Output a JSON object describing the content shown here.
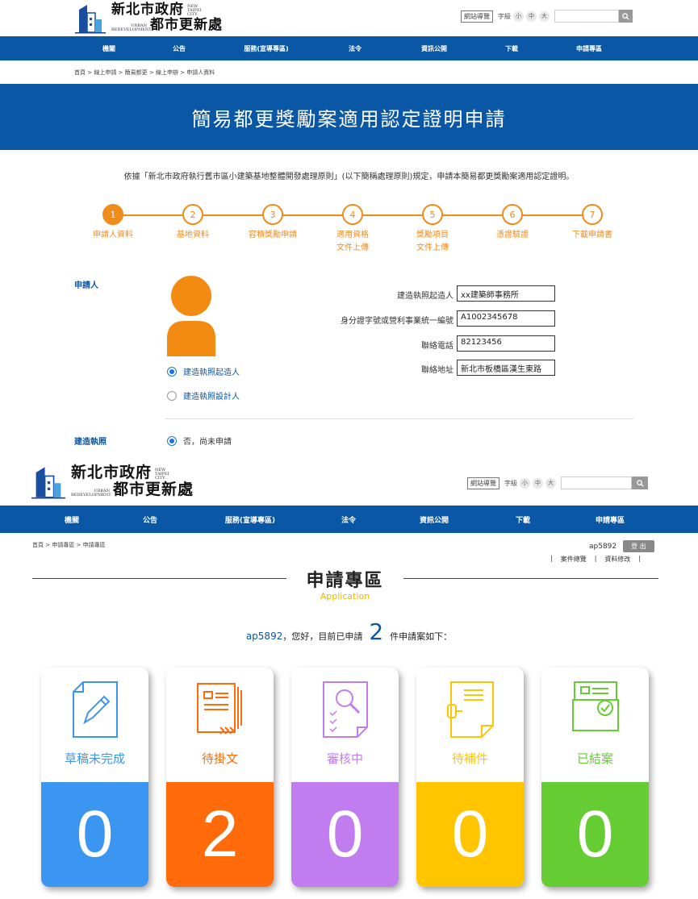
{
  "section1": {
    "logo": {
      "name_top": "新北市政府",
      "name_bottom": "都市更新處",
      "tag_en_top": "NEW TAIPEI CITY",
      "tag_en_bottom": "URBAN REDEVELOPMENT"
    },
    "tools": {
      "sitemap": "網站導覽",
      "font_label": "字級",
      "font_small": "小",
      "font_mid": "中",
      "font_large": "大",
      "search_placeholder": ""
    },
    "nav": [
      "機關",
      "公告",
      "服務(宣導專區)",
      "法令",
      "資訊公開",
      "下載",
      "申請專區"
    ],
    "breadcrumb": "首頁 > 線上申請 > 簡易都更 > 線上申辦 > 申請人資料",
    "banner_title": "簡易都更獎勵案適用認定證明申請",
    "intro": "依據「新北市政府執行舊市區小建築基地整體開發處理原則」(以下簡稱處理原則)規定，申請本簡易都更獎勵案適用認定證明。",
    "steps": [
      {
        "num": "1",
        "label1": "申請人資料",
        "label2": ""
      },
      {
        "num": "2",
        "label1": "基地資料",
        "label2": ""
      },
      {
        "num": "3",
        "label1": "容積獎勵申請",
        "label2": ""
      },
      {
        "num": "4",
        "label1": "適用資格",
        "label2": "文件上傳"
      },
      {
        "num": "5",
        "label1": "獎勵項目",
        "label2": "文件上傳"
      },
      {
        "num": "6",
        "label1": "憑證驗證",
        "label2": ""
      },
      {
        "num": "7",
        "label1": "下載申請書",
        "label2": ""
      }
    ],
    "applicant_label": "申請人",
    "radio_builder": "建造執照起造人",
    "radio_designer": "建造執照設計人",
    "fields": [
      {
        "label": "建造執照起造人",
        "value": "xx建築師事務所"
      },
      {
        "label": "身分證字號或營利事業統一編號",
        "value": "A1002345678"
      },
      {
        "label": "聯絡電話",
        "value": "82123456"
      },
      {
        "label": "聯絡地址",
        "value": "新北市板橋區漢生東路"
      }
    ],
    "permit_label": "建造執照",
    "permit_option": "否，尚未申請"
  },
  "section2": {
    "logo": {
      "name_top": "新北市政府",
      "name_bottom": "都市更新處",
      "tag_en_top": "NEW TAIPEI CITY",
      "tag_en_bottom": "URBAN REDEVELOPMENT"
    },
    "tools": {
      "sitemap": "網站導覽",
      "font_label": "字級",
      "font_small": "小",
      "font_mid": "中",
      "font_large": "大"
    },
    "nav": [
      "機關",
      "公告",
      "服務(宣導專區)",
      "法令",
      "資訊公開",
      "下載",
      "申請專區"
    ],
    "breadcrumb": "首頁 > 申請專區 > 申請專區",
    "username": "ap5892",
    "logout": "登 出",
    "link_overview": "案件總覽",
    "link_edit": "資料修改",
    "title": "申請專區",
    "subtitle": "Application",
    "greet_user": "ap5892",
    "greet_mid": "，您好，目前已申請",
    "greet_count": "2",
    "greet_end": "件申請案如下：",
    "cards": [
      {
        "label": "草稿未完成",
        "count": "0",
        "color": "#3b96f2",
        "icon": "pencil-doc-icon"
      },
      {
        "label": "待掛文",
        "count": "2",
        "color": "#ff6a0b",
        "icon": "stack-doc-icon"
      },
      {
        "label": "審核中",
        "count": "0",
        "color": "#c17df0",
        "icon": "magnify-doc-icon"
      },
      {
        "label": "待補件",
        "count": "0",
        "color": "#fec500",
        "icon": "clip-doc-icon"
      },
      {
        "label": "已結案",
        "count": "0",
        "color": "#66cc33",
        "icon": "folder-check-icon"
      }
    ]
  }
}
